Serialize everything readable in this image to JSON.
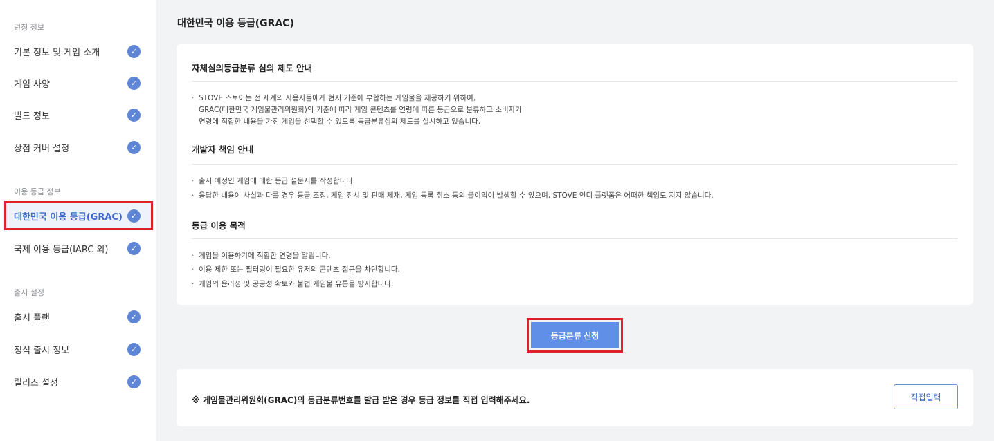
{
  "sidebar": {
    "sections": [
      {
        "title": "런칭 정보",
        "items": [
          {
            "label": "기본 정보 및 게임 소개",
            "checked": true
          },
          {
            "label": "게임 사양",
            "checked": true
          },
          {
            "label": "빌드 정보",
            "checked": true
          },
          {
            "label": "상점 커버 설정",
            "checked": true
          }
        ]
      },
      {
        "title": "이용 등급 정보",
        "items": [
          {
            "label": "대한민국 이용 등급(GRAC)",
            "checked": true,
            "active": true
          },
          {
            "label": "국제 이용 등급(IARC 외)",
            "checked": true
          }
        ]
      },
      {
        "title": "출시 설정",
        "items": [
          {
            "label": "출시 플랜",
            "checked": true
          },
          {
            "label": "정식 출시 정보",
            "checked": true
          },
          {
            "label": "릴리즈 설정",
            "checked": true
          }
        ]
      }
    ],
    "check_icon": "✓"
  },
  "main": {
    "title": "대한민국 이용 등급(GRAC)",
    "info_card": {
      "sections": [
        {
          "heading": "자체심의등급분류 심의 제도 안내",
          "lines": [
            "STOVE 스토어는 전 세계의 사용자들에게 현지 기준에 부합하는 게임물을 제공하기 위하여,",
            "GRAC(대한민국 게임물관리위원회)의 기준에 따라 게임 콘텐츠를 연령에 따른 등급으로 분류하고 소비자가",
            "연령에 적합한 내용을 가진 게임을 선택할 수 있도록 등급분류심의 제도를 실시하고 있습니다."
          ]
        },
        {
          "heading": "개발자 책임 안내",
          "lines": [
            "출시 예정인 게임에 대한 등급 설문지를 작성합니다.",
            "응답한 내용이 사실과 다를 경우 등급 조정, 게임 전시 및 판매 제재, 게임 등록 취소 등의 불이익이 발생할 수 있으며, STOVE 인디 플랫폼은 어떠한 책임도 지지 않습니다."
          ]
        },
        {
          "heading": "등급 이용 목적",
          "lines": [
            "게임을 이용하기에 적합한 연령을 알립니다.",
            "이용 제한 또는 필터링이 필요한 유저의 콘텐츠 접근을 차단합니다.",
            "게임의 윤리성 및 공공성 확보와 불법 게임물 유통을 방지합니다."
          ]
        }
      ],
      "bullet": "·"
    },
    "apply_button": "등급분류 신청",
    "notice_card": {
      "text": "※ 게임물관리위원회(GRAC)의 등급분류번호를 발급 받은 경우 등급 정보를 직접 입력해주세요.",
      "button": "직접입력"
    }
  },
  "colors": {
    "accent": "#5f86d4",
    "button": "#5f8fe6",
    "highlight_border": "#e0202a",
    "active_text": "#3f6ac9"
  }
}
